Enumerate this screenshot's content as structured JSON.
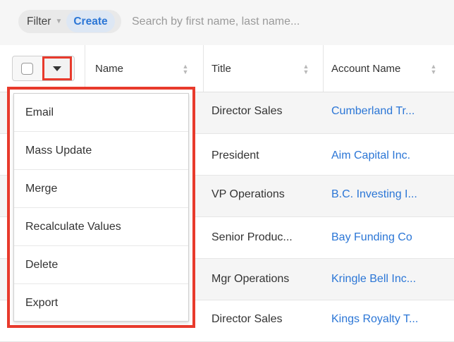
{
  "filter": {
    "label": "Filter",
    "create_label": "Create",
    "search_placeholder": "Search by first name, last name..."
  },
  "table": {
    "columns": [
      "Name",
      "Title",
      "Account Name"
    ],
    "rows": [
      {
        "title": "Director Sales",
        "account": "Cumberland Tr..."
      },
      {
        "title": "President",
        "account": "Aim Capital Inc."
      },
      {
        "title": "VP Operations",
        "account": "B.C. Investing I..."
      },
      {
        "title": "Senior Produc...",
        "account": "Bay Funding Co"
      },
      {
        "title": "Mgr Operations",
        "account": "Kringle Bell Inc..."
      },
      {
        "title": "Director Sales",
        "account": "Kings Royalty T..."
      }
    ]
  },
  "menu": {
    "items": [
      "Email",
      "Mass Update",
      "Merge",
      "Recalculate Values",
      "Delete",
      "Export"
    ]
  },
  "colors": {
    "accent": "#2b76d6",
    "highlight": "#e83a2c"
  }
}
